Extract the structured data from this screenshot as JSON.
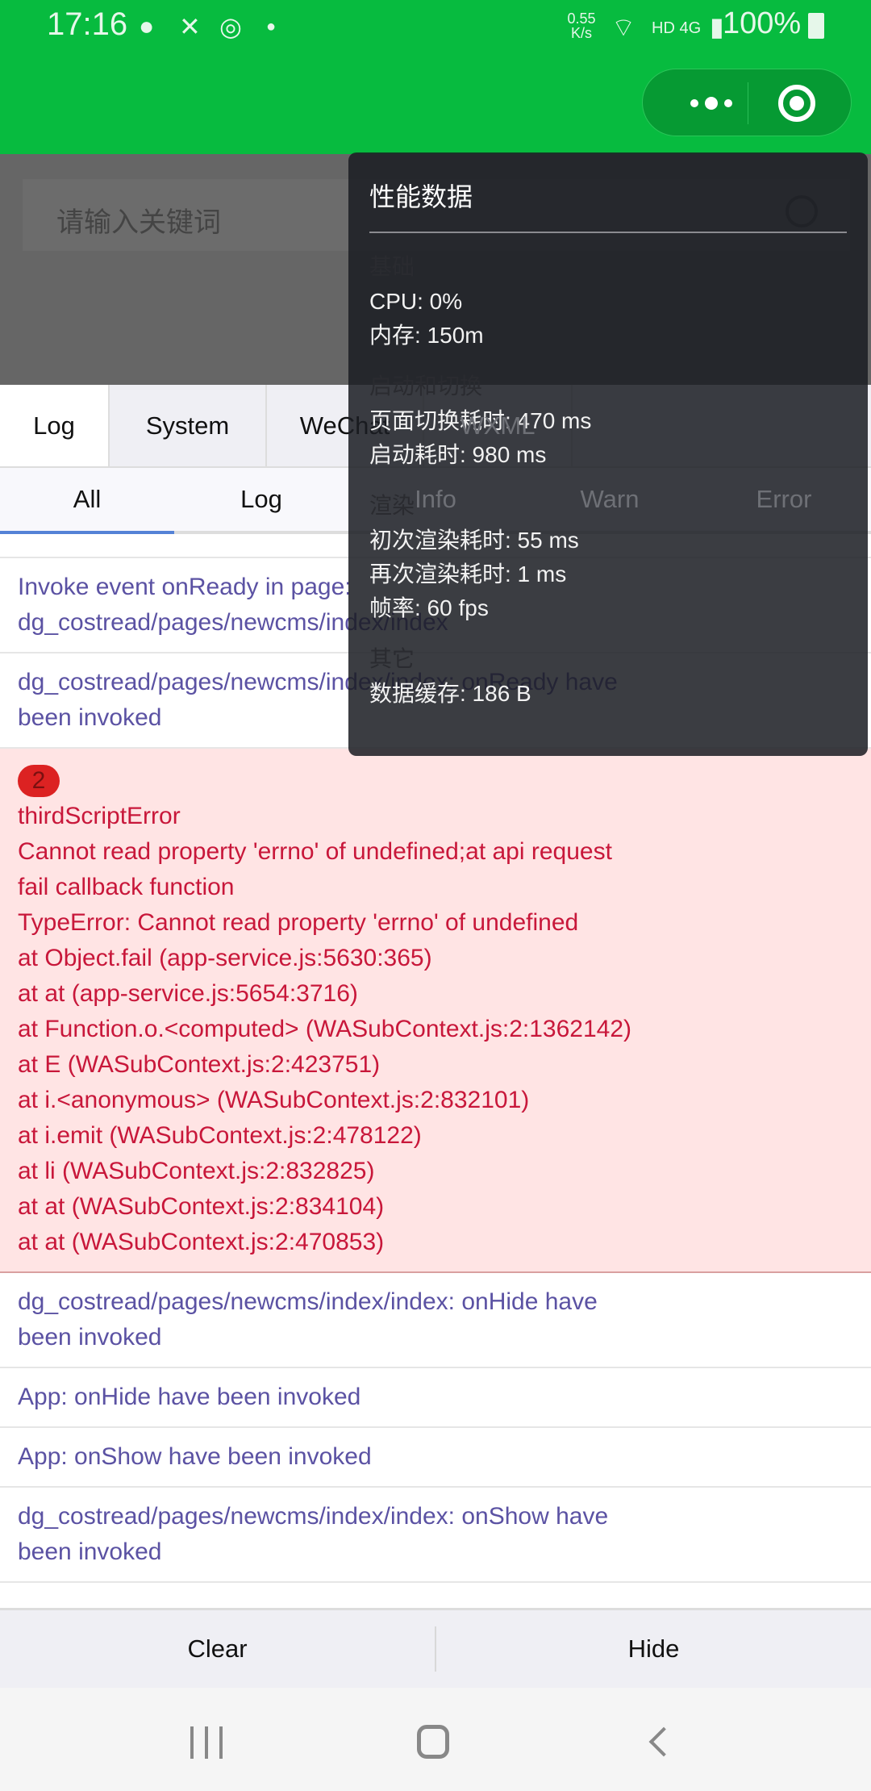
{
  "status_bar": {
    "time": "17:16",
    "net_speed": "0.55 K/s",
    "network": "HD 4G",
    "battery": "100%",
    "icons": [
      "app-notification-icon",
      "missed-call-icon",
      "sync-icon",
      "dot-icon",
      "wifi-icon",
      "signal-icon",
      "battery-icon"
    ]
  },
  "capsule": {
    "more_icon": "more-dots-icon",
    "close_icon": "target-circle-icon"
  },
  "search": {
    "placeholder": "请输入关键词"
  },
  "tabs": [
    {
      "label": "Log"
    },
    {
      "label": "System"
    },
    {
      "label": "WeChat"
    },
    {
      "label": "WXML"
    }
  ],
  "filters": [
    {
      "label": "All"
    },
    {
      "label": "Log"
    },
    {
      "label": "Info"
    },
    {
      "label": "Warn"
    },
    {
      "label": "Error"
    }
  ],
  "logs": [
    {
      "lines": [
        "Invoke event onReady in page:",
        "dg_costread/pages/newcms/index/index"
      ]
    },
    {
      "lines": [
        "dg_costread/pages/newcms/index/index: onReady have",
        "been invoked"
      ]
    },
    {
      "type": "error",
      "count": "2",
      "lines": [
        "thirdScriptError",
        "Cannot read property 'errno' of undefined;at api request",
        "fail callback function",
        "TypeError: Cannot read property 'errno' of undefined",
        "at Object.fail (app-service.js:5630:365)",
        "at at (app-service.js:5654:3716)",
        "at Function.o.<computed> (WASubContext.js:2:1362142)",
        "at E (WASubContext.js:2:423751)",
        "at i.<anonymous> (WASubContext.js:2:832101)",
        "at i.emit (WASubContext.js:2:478122)",
        "at li (WASubContext.js:2:832825)",
        "at at (WASubContext.js:2:834104)",
        "at at (WASubContext.js:2:470853)"
      ]
    },
    {
      "lines": [
        "dg_costread/pages/newcms/index/index: onHide have",
        "been invoked"
      ]
    },
    {
      "lines": [
        "App: onHide have been invoked"
      ]
    },
    {
      "lines": [
        "App: onShow have been invoked"
      ]
    },
    {
      "lines": [
        "dg_costread/pages/newcms/index/index: onShow have",
        "been invoked"
      ]
    }
  ],
  "bottom": {
    "clear": "Clear",
    "hide": "Hide"
  },
  "perf": {
    "title": "性能数据",
    "sections": [
      {
        "name": "基础",
        "items": [
          "CPU: 0%",
          "内存: 150m"
        ]
      },
      {
        "name": "启动和切换",
        "items": [
          "页面切换耗时: 470 ms",
          "启动耗时: 980 ms"
        ]
      },
      {
        "name": "渲染",
        "items": [
          "初次渲染耗时: 55 ms",
          "再次渲染耗时: 1 ms",
          "帧率: 60 fps"
        ]
      },
      {
        "name": "其它",
        "items": [
          "数据缓存: 186 B"
        ]
      }
    ]
  },
  "colors": {
    "header_green": "#07bb3f",
    "log_text": "#5b52a3",
    "error_text": "#c8173a",
    "error_bg": "#ffe4e4",
    "active_underline": "#5482d6"
  }
}
